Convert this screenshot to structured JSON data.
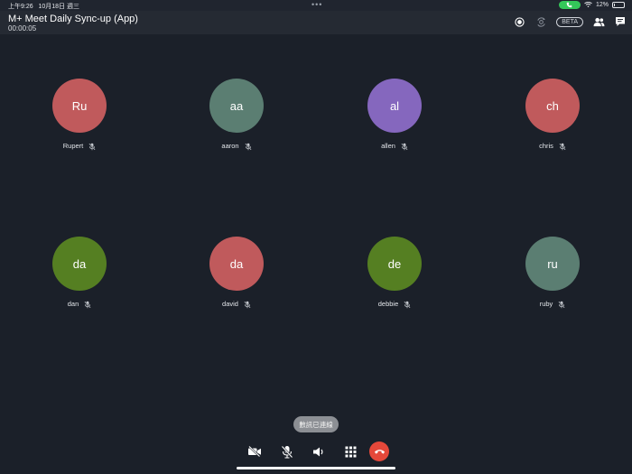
{
  "status_bar": {
    "time": "上午9:26",
    "date": "10月18日 週三",
    "dots": "•••",
    "battery": "12%",
    "battery_level": 0.12
  },
  "header": {
    "title": "M+ Meet Daily Sync-up (App)",
    "timer": "00:00:05",
    "beta_label": "BETA"
  },
  "participants": [
    {
      "initials": "Ru",
      "name": "Rupert",
      "color": "#c05a5c",
      "muted": true
    },
    {
      "initials": "aa",
      "name": "aaron",
      "color": "#5b7e72",
      "muted": true
    },
    {
      "initials": "al",
      "name": "allen",
      "color": "#8567be",
      "muted": true
    },
    {
      "initials": "ch",
      "name": "chris",
      "color": "#c05a5c",
      "muted": true
    },
    {
      "initials": "da",
      "name": "dan",
      "color": "#557f22",
      "muted": true
    },
    {
      "initials": "da",
      "name": "david",
      "color": "#c05a5c",
      "muted": true
    },
    {
      "initials": "de",
      "name": "debbie",
      "color": "#557f22",
      "muted": true
    },
    {
      "initials": "ru",
      "name": "ruby",
      "color": "#5b7e72",
      "muted": true
    }
  ],
  "toast": {
    "text": "數訊已連線"
  },
  "controls": {
    "camera": "camera-off-icon",
    "mic": "mic-off-icon",
    "speaker": "speaker-icon",
    "keypad": "keypad-icon",
    "end": "end-call-icon"
  },
  "colors": {
    "end_call": "#e5483a",
    "call_active": "#34c759",
    "background": "#1b2029"
  }
}
